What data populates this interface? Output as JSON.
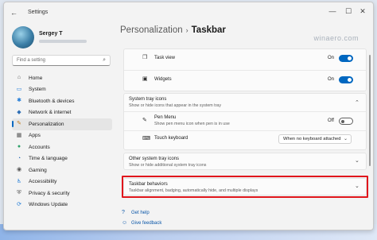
{
  "window": {
    "app_title": "Settings",
    "controls": {
      "minimize": "—",
      "maximize": "☐",
      "close": "✕"
    }
  },
  "profile": {
    "name": "Sergey T"
  },
  "search": {
    "placeholder": "Find a setting"
  },
  "sidebar": {
    "items": [
      {
        "label": "Home",
        "icon": "home-icon",
        "glyph": "⌂",
        "color": "#555555"
      },
      {
        "label": "System",
        "icon": "system-icon",
        "glyph": "▭",
        "color": "#1f7ad6"
      },
      {
        "label": "Bluetooth & devices",
        "icon": "bluetooth-icon",
        "glyph": "✱",
        "color": "#1f7ad6"
      },
      {
        "label": "Network & internet",
        "icon": "network-icon",
        "glyph": "◆",
        "color": "#2f6fb5"
      },
      {
        "label": "Personalization",
        "icon": "personalization-icon",
        "glyph": "✎",
        "color": "#c07a1e",
        "active": true
      },
      {
        "label": "Apps",
        "icon": "apps-icon",
        "glyph": "▦",
        "color": "#555555"
      },
      {
        "label": "Accounts",
        "icon": "accounts-icon",
        "glyph": "●",
        "color": "#2fa06a"
      },
      {
        "label": "Time & language",
        "icon": "clock-icon",
        "glyph": "◔",
        "color": "#2f6fb5"
      },
      {
        "label": "Gaming",
        "icon": "gaming-icon",
        "glyph": "◉",
        "color": "#555555"
      },
      {
        "label": "Accessibility",
        "icon": "accessibility-icon",
        "glyph": "♿",
        "color": "#1f7ad6"
      },
      {
        "label": "Privacy & security",
        "icon": "shield-icon",
        "glyph": "⛨",
        "color": "#555555"
      },
      {
        "label": "Windows Update",
        "icon": "update-icon",
        "glyph": "⟳",
        "color": "#1f7ad6"
      }
    ]
  },
  "breadcrumb": {
    "parent": "Personalization",
    "separator": "›",
    "current": "Taskbar"
  },
  "watermark": "winaero.com",
  "taskbar_items": [
    {
      "label": "Task view",
      "state": "On",
      "on": true,
      "icon": "task-view-icon"
    },
    {
      "label": "Widgets",
      "state": "On",
      "on": true,
      "icon": "widgets-icon"
    }
  ],
  "system_tray": {
    "title": "System tray icons",
    "subtitle": "Show or hide icons that appear in the system tray",
    "pen_menu": {
      "label": "Pen Menu",
      "subtitle": "Show pen menu icon when pen is in use",
      "state": "Off"
    },
    "touch_keyboard": {
      "label": "Touch keyboard",
      "value": "When no keyboard attached"
    }
  },
  "other_tray": {
    "title": "Other system tray icons",
    "subtitle": "Show or hide additional system tray icons"
  },
  "behaviors": {
    "title": "Taskbar behaviors",
    "subtitle": "Taskbar alignment, badging, automatically hide, and multiple displays"
  },
  "links": {
    "help": "Get help",
    "feedback": "Give feedback"
  },
  "colors": {
    "accent": "#0067c0",
    "highlight": "#e0161c"
  }
}
